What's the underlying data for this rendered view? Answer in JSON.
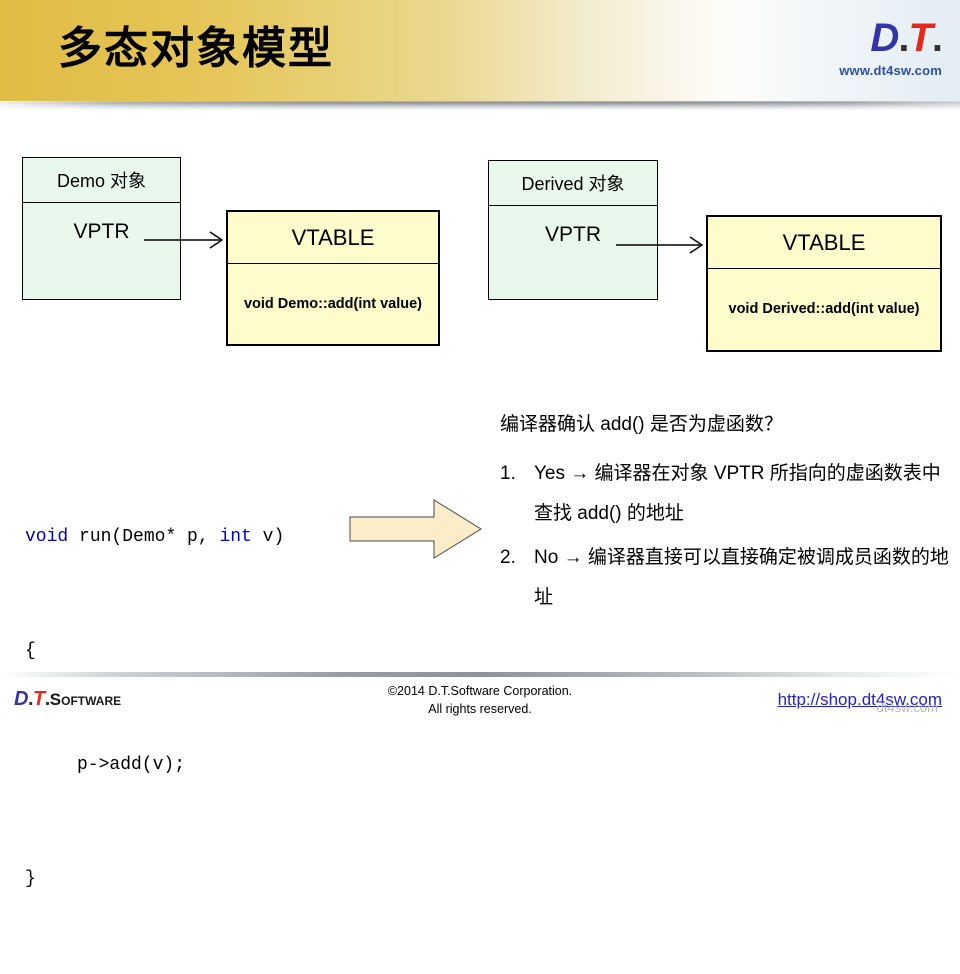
{
  "header": {
    "title": "多态对象模型",
    "logo": {
      "d": "D",
      "dot1": ".",
      "t": "T",
      "dot2": ".",
      "url": "www.dt4sw.com"
    }
  },
  "diagram": {
    "left": {
      "object_box": {
        "title": "Demo 对象",
        "field": "VPTR"
      },
      "vtable_box": {
        "title": "VTABLE",
        "entry": "void Demo::add(int value)"
      }
    },
    "right": {
      "object_box": {
        "title": "Derived 对象",
        "field": "VPTR"
      },
      "vtable_box": {
        "title": "VTABLE",
        "entry": "void Derived::add(int value)"
      }
    }
  },
  "code": {
    "line1_kw1": "void",
    "line1_rest": " run(Demo* p, ",
    "line1_kw2": "int",
    "line1_tail": " v)",
    "line2": "{",
    "line3": "p->add(v);",
    "line4": "}"
  },
  "notes": {
    "heading": "编译器确认 add() 是否为虚函数？",
    "items": [
      {
        "num": "1.",
        "text": "Yes → 编译器在对象 VPTR 所指向的虚函数表中查找 add() 的地址"
      },
      {
        "num": "2.",
        "text": "No → 编译器直接可以直接确定被调成员函数的地址"
      }
    ]
  },
  "footer": {
    "logo": {
      "d": "D",
      "dot1": ".",
      "t": "T",
      "dot2": ".",
      "software": "Software"
    },
    "copyright_line1": "©2014 D.T.Software Corporation.",
    "copyright_line2": "All rights reserved.",
    "link": "http://shop.dt4sw.com",
    "watermark": "dt4sw.com"
  },
  "colors": {
    "band_gold": "#e0bc45",
    "object_box_fill": "#e9f8ec",
    "vtable_fill": "#fefcca",
    "arrow_fill": "#fdecc8",
    "keyword_blue": "#0000cd",
    "link_blue": "#2222cc",
    "logo_blue": "#3333aa",
    "logo_red": "#e8261c"
  }
}
